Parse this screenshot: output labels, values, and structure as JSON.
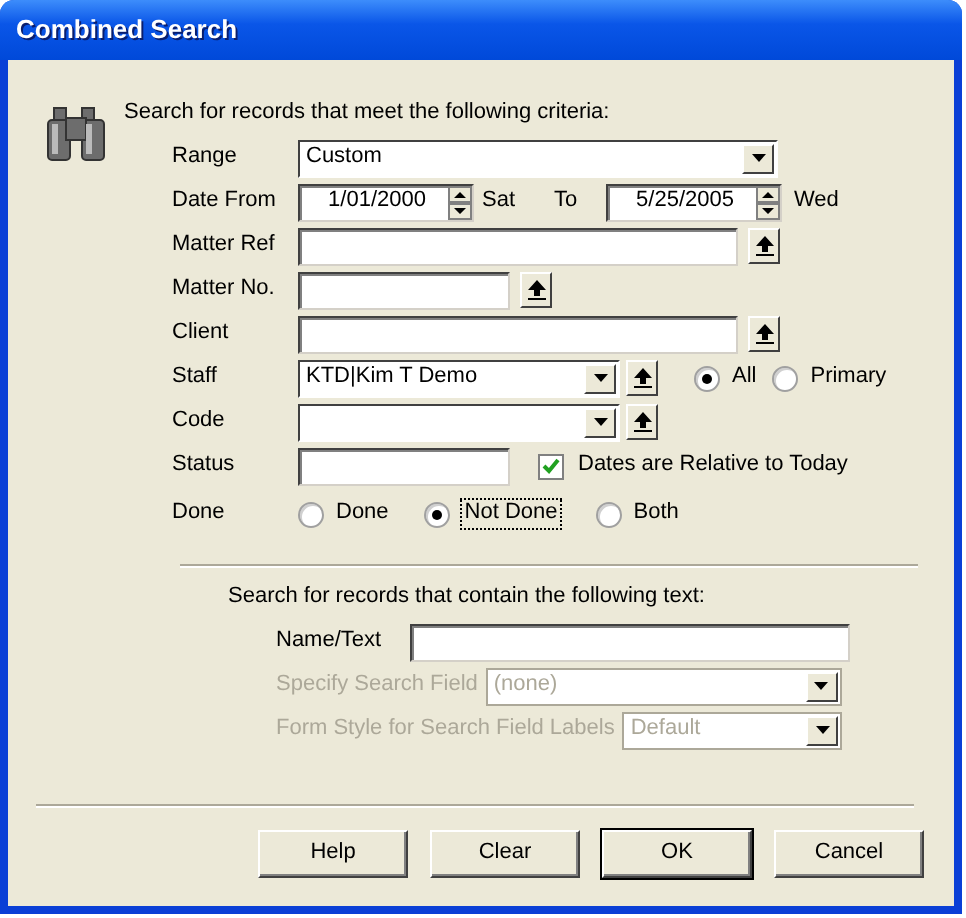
{
  "window": {
    "title": "Combined Search"
  },
  "criteria": {
    "heading": "Search for records that meet the following criteria:",
    "rows": [
      {
        "kind": "dropdown",
        "label": "Range",
        "value": "Custom"
      },
      {
        "kind": "dates",
        "label": "Date From",
        "value": "1/01/2000",
        "weekday": "Sat",
        "to_label": "To",
        "to_value": "5/25/2005",
        "to_weekday": "Wed"
      },
      {
        "kind": "lookup",
        "label": "Matter Ref"
      },
      {
        "kind": "shortlookup",
        "label": "Matter No."
      },
      {
        "kind": "lookup",
        "label": "Client"
      },
      {
        "kind": "combolookup",
        "label": "Staff",
        "value": "KTD|Kim T Demo",
        "options": [
          {
            "label": "All",
            "selected": true
          },
          {
            "label": "Primary",
            "selected": false
          }
        ]
      },
      {
        "kind": "combolookup",
        "label": "Code"
      },
      {
        "kind": "status",
        "label": "Status",
        "checkbox": {
          "label": "Dates are Relative to Today",
          "checked": true
        }
      },
      {
        "kind": "radios",
        "label": "Done",
        "options": [
          {
            "label": "Done",
            "selected": false
          },
          {
            "label": "Not Done",
            "selected": true
          },
          {
            "label": "Both",
            "selected": false
          }
        ]
      }
    ]
  },
  "text_search": {
    "heading": "Search for records that contain the following text:",
    "rows": [
      {
        "kind": "text",
        "label": "Name/Text",
        "disabled": false
      },
      {
        "kind": "select",
        "label": "Specify Search Field",
        "value": "(none)",
        "disabled": true
      },
      {
        "kind": "select",
        "label": "Form Style for Search Field Labels",
        "value": "Default",
        "disabled": true
      }
    ]
  },
  "buttons": [
    {
      "label": "Help",
      "default": false
    },
    {
      "label": "Clear",
      "default": false
    },
    {
      "label": "OK",
      "default": true
    },
    {
      "label": "Cancel",
      "default": false
    }
  ]
}
